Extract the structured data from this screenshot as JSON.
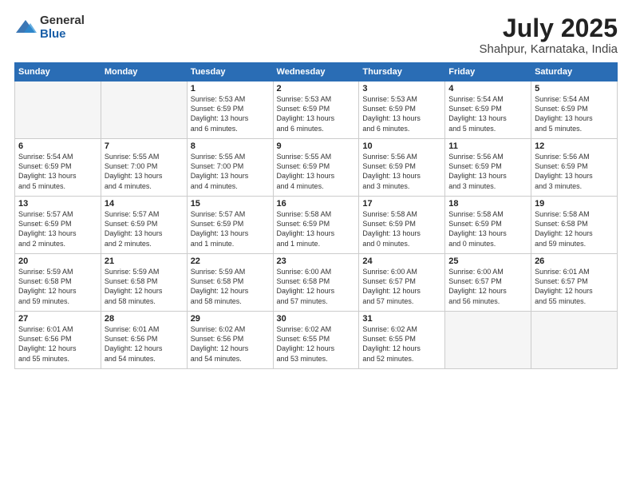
{
  "logo": {
    "general": "General",
    "blue": "Blue"
  },
  "title": "July 2025",
  "location": "Shahpur, Karnataka, India",
  "headers": [
    "Sunday",
    "Monday",
    "Tuesday",
    "Wednesday",
    "Thursday",
    "Friday",
    "Saturday"
  ],
  "weeks": [
    [
      {
        "day": "",
        "info": ""
      },
      {
        "day": "",
        "info": ""
      },
      {
        "day": "1",
        "info": "Sunrise: 5:53 AM\nSunset: 6:59 PM\nDaylight: 13 hours\nand 6 minutes."
      },
      {
        "day": "2",
        "info": "Sunrise: 5:53 AM\nSunset: 6:59 PM\nDaylight: 13 hours\nand 6 minutes."
      },
      {
        "day": "3",
        "info": "Sunrise: 5:53 AM\nSunset: 6:59 PM\nDaylight: 13 hours\nand 6 minutes."
      },
      {
        "day": "4",
        "info": "Sunrise: 5:54 AM\nSunset: 6:59 PM\nDaylight: 13 hours\nand 5 minutes."
      },
      {
        "day": "5",
        "info": "Sunrise: 5:54 AM\nSunset: 6:59 PM\nDaylight: 13 hours\nand 5 minutes."
      }
    ],
    [
      {
        "day": "6",
        "info": "Sunrise: 5:54 AM\nSunset: 6:59 PM\nDaylight: 13 hours\nand 5 minutes."
      },
      {
        "day": "7",
        "info": "Sunrise: 5:55 AM\nSunset: 7:00 PM\nDaylight: 13 hours\nand 4 minutes."
      },
      {
        "day": "8",
        "info": "Sunrise: 5:55 AM\nSunset: 7:00 PM\nDaylight: 13 hours\nand 4 minutes."
      },
      {
        "day": "9",
        "info": "Sunrise: 5:55 AM\nSunset: 6:59 PM\nDaylight: 13 hours\nand 4 minutes."
      },
      {
        "day": "10",
        "info": "Sunrise: 5:56 AM\nSunset: 6:59 PM\nDaylight: 13 hours\nand 3 minutes."
      },
      {
        "day": "11",
        "info": "Sunrise: 5:56 AM\nSunset: 6:59 PM\nDaylight: 13 hours\nand 3 minutes."
      },
      {
        "day": "12",
        "info": "Sunrise: 5:56 AM\nSunset: 6:59 PM\nDaylight: 13 hours\nand 3 minutes."
      }
    ],
    [
      {
        "day": "13",
        "info": "Sunrise: 5:57 AM\nSunset: 6:59 PM\nDaylight: 13 hours\nand 2 minutes."
      },
      {
        "day": "14",
        "info": "Sunrise: 5:57 AM\nSunset: 6:59 PM\nDaylight: 13 hours\nand 2 minutes."
      },
      {
        "day": "15",
        "info": "Sunrise: 5:57 AM\nSunset: 6:59 PM\nDaylight: 13 hours\nand 1 minute."
      },
      {
        "day": "16",
        "info": "Sunrise: 5:58 AM\nSunset: 6:59 PM\nDaylight: 13 hours\nand 1 minute."
      },
      {
        "day": "17",
        "info": "Sunrise: 5:58 AM\nSunset: 6:59 PM\nDaylight: 13 hours\nand 0 minutes."
      },
      {
        "day": "18",
        "info": "Sunrise: 5:58 AM\nSunset: 6:59 PM\nDaylight: 13 hours\nand 0 minutes."
      },
      {
        "day": "19",
        "info": "Sunrise: 5:58 AM\nSunset: 6:58 PM\nDaylight: 12 hours\nand 59 minutes."
      }
    ],
    [
      {
        "day": "20",
        "info": "Sunrise: 5:59 AM\nSunset: 6:58 PM\nDaylight: 12 hours\nand 59 minutes."
      },
      {
        "day": "21",
        "info": "Sunrise: 5:59 AM\nSunset: 6:58 PM\nDaylight: 12 hours\nand 58 minutes."
      },
      {
        "day": "22",
        "info": "Sunrise: 5:59 AM\nSunset: 6:58 PM\nDaylight: 12 hours\nand 58 minutes."
      },
      {
        "day": "23",
        "info": "Sunrise: 6:00 AM\nSunset: 6:58 PM\nDaylight: 12 hours\nand 57 minutes."
      },
      {
        "day": "24",
        "info": "Sunrise: 6:00 AM\nSunset: 6:57 PM\nDaylight: 12 hours\nand 57 minutes."
      },
      {
        "day": "25",
        "info": "Sunrise: 6:00 AM\nSunset: 6:57 PM\nDaylight: 12 hours\nand 56 minutes."
      },
      {
        "day": "26",
        "info": "Sunrise: 6:01 AM\nSunset: 6:57 PM\nDaylight: 12 hours\nand 55 minutes."
      }
    ],
    [
      {
        "day": "27",
        "info": "Sunrise: 6:01 AM\nSunset: 6:56 PM\nDaylight: 12 hours\nand 55 minutes."
      },
      {
        "day": "28",
        "info": "Sunrise: 6:01 AM\nSunset: 6:56 PM\nDaylight: 12 hours\nand 54 minutes."
      },
      {
        "day": "29",
        "info": "Sunrise: 6:02 AM\nSunset: 6:56 PM\nDaylight: 12 hours\nand 54 minutes."
      },
      {
        "day": "30",
        "info": "Sunrise: 6:02 AM\nSunset: 6:55 PM\nDaylight: 12 hours\nand 53 minutes."
      },
      {
        "day": "31",
        "info": "Sunrise: 6:02 AM\nSunset: 6:55 PM\nDaylight: 12 hours\nand 52 minutes."
      },
      {
        "day": "",
        "info": ""
      },
      {
        "day": "",
        "info": ""
      }
    ]
  ]
}
